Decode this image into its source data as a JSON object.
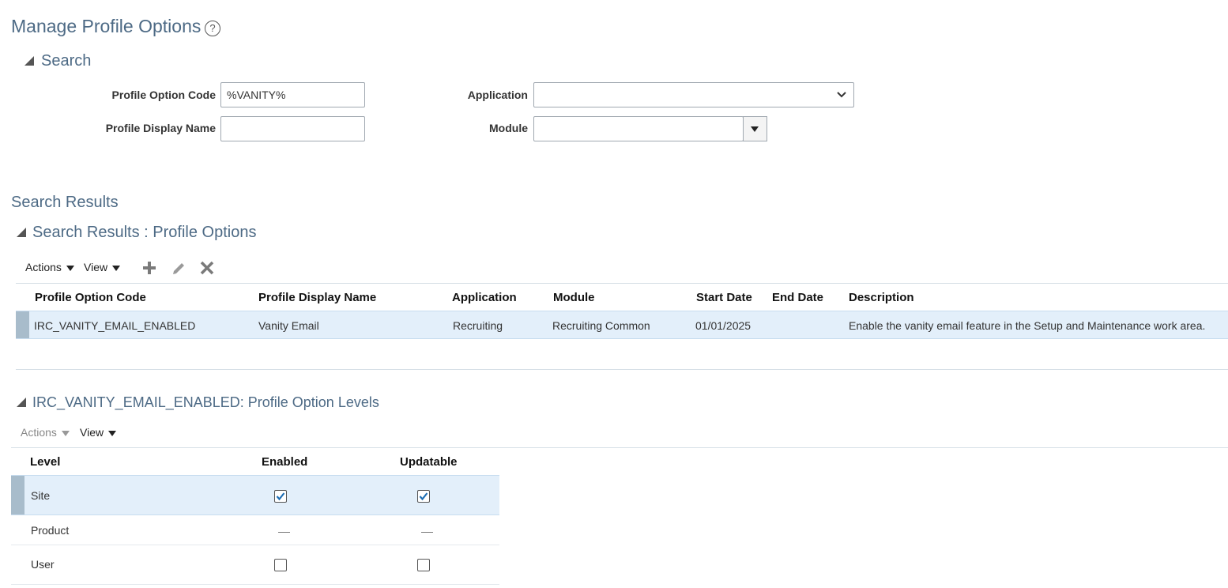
{
  "page": {
    "title": "Manage Profile Options",
    "help_icon": "question-circle-icon"
  },
  "search": {
    "title": "Search",
    "profile_option_code_label": "Profile Option Code",
    "profile_option_code_value": "%VANITY%",
    "profile_display_name_label": "Profile Display Name",
    "profile_display_name_value": "",
    "application_label": "Application",
    "application_value": "",
    "module_label": "Module",
    "module_value": ""
  },
  "results": {
    "heading": "Search Results",
    "section_title": "Search Results : Profile Options",
    "toolbar": {
      "actions_label": "Actions",
      "view_label": "View",
      "icons": [
        "add-icon",
        "edit-pencil-icon",
        "delete-x-icon"
      ]
    },
    "columns": [
      "Profile Option Code",
      "Profile Display Name",
      "Application",
      "Module",
      "Start Date",
      "End Date",
      "Description"
    ],
    "rows": [
      {
        "code": "IRC_VANITY_EMAIL_ENABLED",
        "display_name": "Vanity Email",
        "application": "Recruiting",
        "module": "Recruiting Common",
        "start_date": "01/01/2025",
        "end_date": "",
        "description": "Enable the vanity email feature in the Setup and Maintenance work area."
      }
    ]
  },
  "levels": {
    "section_title": "IRC_VANITY_EMAIL_ENABLED: Profile Option Levels",
    "toolbar": {
      "actions_label": "Actions",
      "view_label": "View"
    },
    "columns": [
      "Level",
      "Enabled",
      "Updatable"
    ],
    "rows": [
      {
        "level": "Site",
        "enabled": "checked",
        "updatable": "checked"
      },
      {
        "level": "Product",
        "enabled": "na",
        "updatable": "na"
      },
      {
        "level": "User",
        "enabled": "unchecked",
        "updatable": "unchecked"
      }
    ]
  },
  "colors": {
    "heading": "#4d6a85",
    "selected_row": "#e3effa",
    "row_marker": "#a8bccb",
    "checkbox_accent": "#1f6fb5"
  }
}
